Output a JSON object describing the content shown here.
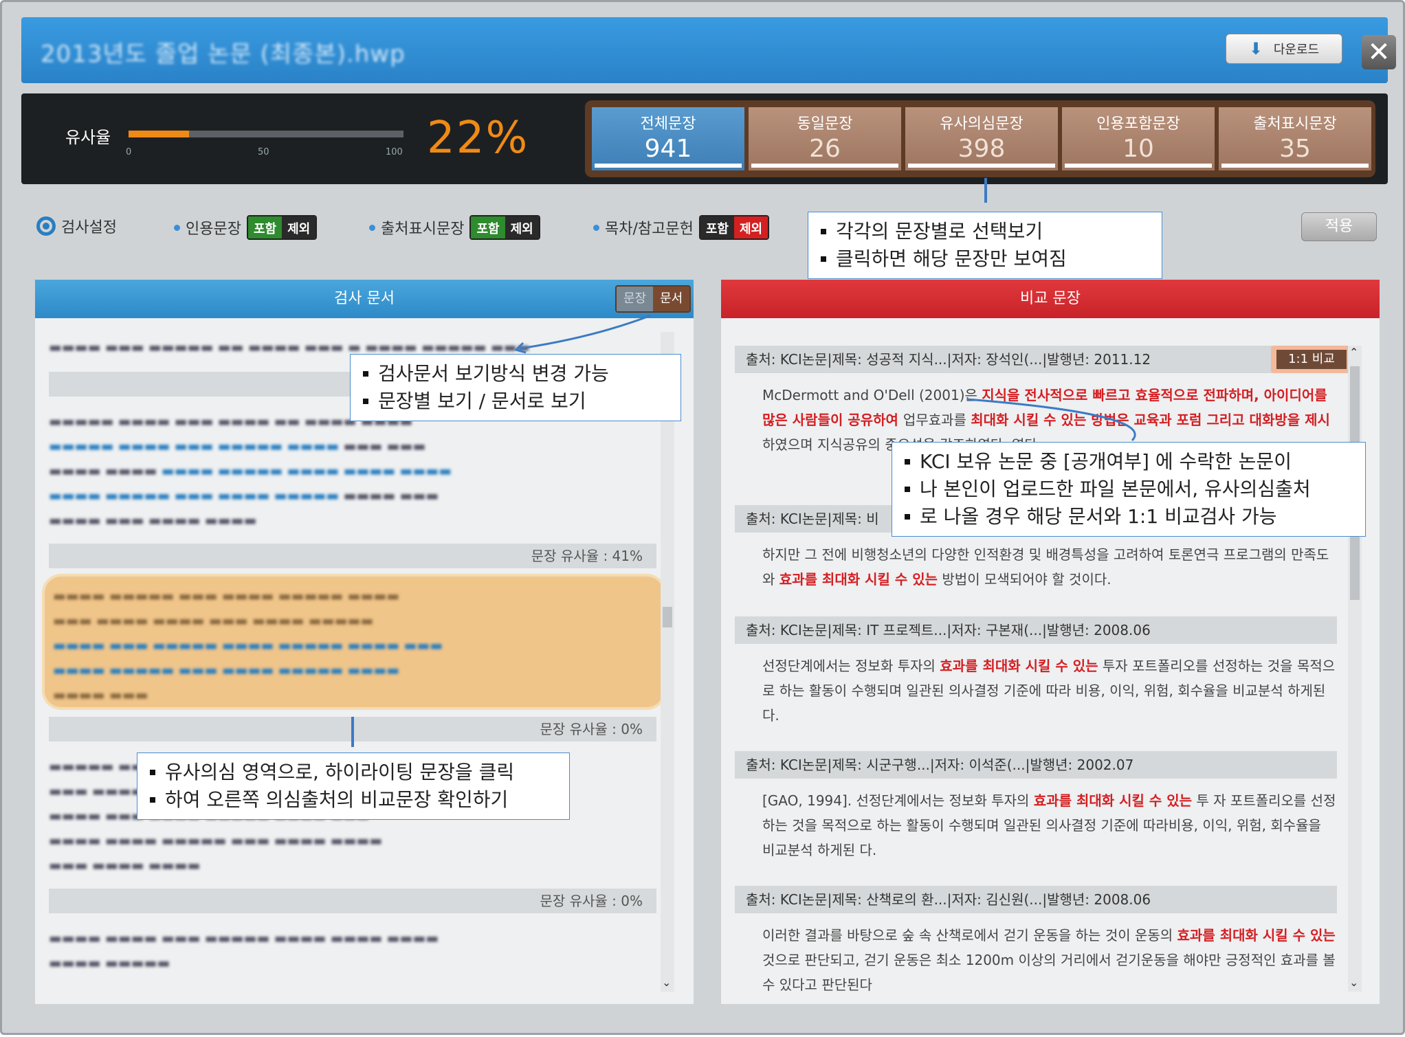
{
  "window": {
    "title": "2013년도 졸업 논문 (최종본).hwp",
    "download_label": "다운로드",
    "close_label": "✕"
  },
  "stats": {
    "similarity_label": "유사율",
    "similarity_value": 22,
    "similarity_text": "22%",
    "ticks": [
      "0",
      "50",
      "100"
    ],
    "tabs": [
      {
        "label": "전체문장",
        "count": "941",
        "active": true
      },
      {
        "label": "동일문장",
        "count": "26"
      },
      {
        "label": "유사의심문장",
        "count": "398"
      },
      {
        "label": "인용포함문장",
        "count": "10"
      },
      {
        "label": "출처표시문장",
        "count": "35"
      }
    ]
  },
  "settings": {
    "label": "검사설정",
    "items": [
      {
        "label": "인용문장",
        "include": "포함",
        "exclude": "제외"
      },
      {
        "label": "출처표시문장",
        "include": "포함",
        "exclude": "제외"
      },
      {
        "label": "목차/참고문헌",
        "include": "포함",
        "exclude": "제외"
      }
    ],
    "apply_label": "적용"
  },
  "left": {
    "title": "검사 문서",
    "toggle": [
      "문장",
      "문서"
    ],
    "sim_rows": [
      "문장 유사율 : 41%",
      "문장 유사율 : 0%",
      "문장 유사율 : 0%"
    ]
  },
  "right": {
    "title": "비교 문장",
    "compare_label": "1:1 비교",
    "sources": [
      {
        "src": "출처: KCI논문|제목: 성공적 지식...|저자: 장석인(...|발행년: 2011.12",
        "body": [
          {
            "t": "McDermott and O'Dell (2001)은 "
          },
          {
            "t": "지식을 전사적으로 빠르고 효율적으로 전파하며, 아이디어를 많은 사람들이 공유하여 ",
            "r": 1
          },
          {
            "t": "업무효과를 "
          },
          {
            "t": "최대화 시킬 수 있는 방법은 교육과 포럼 그리고 대화방을 제시",
            "r": 1
          },
          {
            "t": "하였으며 지식공유의 중요성을 강조하였다. 였다."
          }
        ]
      },
      {
        "src": "출처: KCI논문|제목: 비",
        "body": [
          {
            "t": "하지만 그 전에 비행청소년의 다양한 인적환경 및 배경특성을 고려하여 토론연극 프로그램의 만족도와 "
          },
          {
            "t": "효과를 최대화 시킬 수 있는",
            "r": 1
          },
          {
            "t": " 방법이 모색되어야 할 것이다."
          }
        ]
      },
      {
        "src": "출처: KCI논문|제목: IT 프로젝트...|저자: 구본재(...|발행년: 2008.06",
        "body": [
          {
            "t": "선정단계에서는 정보화 투자의 "
          },
          {
            "t": "효과를 최대화 시킬 수 있는",
            "r": 1
          },
          {
            "t": " 투자 포트폴리오를 선정하는 것을 목적으로 하는 활동이 수행되며 일관된 의사결정 기준에 따라 비용, 이익, 위험, 회수율을 비교분석 하게된다."
          }
        ]
      },
      {
        "src": "출처: KCI논문|제목: 시군구행...|저자: 이석준(...|발행년: 2002.07",
        "body": [
          {
            "t": "[GAO, 1994]. 선정단계에서는 정보화 투자의 "
          },
          {
            "t": "효과를 최대화 시킬 수 있는",
            "r": 1
          },
          {
            "t": " 투 자 포트폴리오를 선정하는 것을 목적으로 하는 활동이 수행되며 일관된 의사결정 기준에 따라비용, 이익, 위험, 회수율을 비교분석 하게된 다."
          }
        ]
      },
      {
        "src": "출처: KCI논문|제목: 산책로의 환...|저자: 김신원(...|발행년: 2008.06",
        "body": [
          {
            "t": "이러한 결과를 바탕으로 숲 속 산책로에서 걷기 운동을 하는 것이 운동의 "
          },
          {
            "t": "효과를 최대화 시킬 수 있는",
            "r": 1
          },
          {
            "t": " 것으로 판단되고, 걷기 운동은 최소 1200m 이상의 거리에서 걷기운동을 해야만 긍정적인 효과를 볼 수 있다고 판단된다"
          }
        ]
      }
    ]
  },
  "callouts": {
    "c1": [
      "각각의 문장별로 선택보기",
      "클릭하면 해당 문장만 보여짐"
    ],
    "c2": [
      "검사문서 보기방식 변경 가능",
      "문장별 보기 / 문서로 보기"
    ],
    "c3": [
      "KCI 보유 논문 중 [공개여부] 에 수락한 논문이",
      "나 본인이 업로드한 파일 본문에서, 유사의심출처",
      "로 나올 경우 해당 문서와 1:1 비교검사 가능"
    ],
    "c4": [
      "유사의심 영역으로, 하이라이팅 문장을 클릭",
      "하여 오른쪽 의심출처의 비교문장 확인하기"
    ]
  },
  "colors": {
    "accent": "#2a82c8",
    "similarity": "#f08a16",
    "compare": "#c8232a"
  }
}
